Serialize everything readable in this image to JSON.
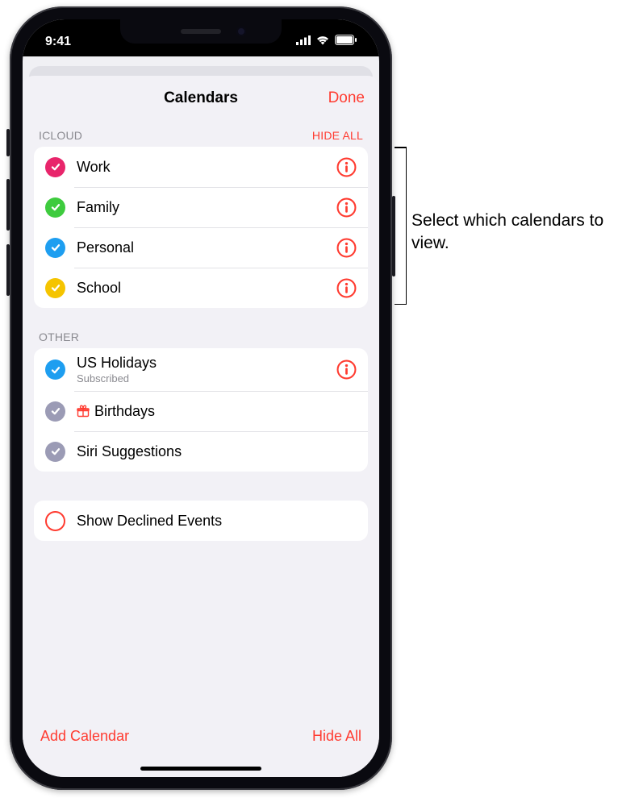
{
  "status": {
    "time": "9:41"
  },
  "header": {
    "title": "Calendars",
    "done": "Done"
  },
  "sections": {
    "icloud": {
      "label": "ICLOUD",
      "hide": "HIDE ALL",
      "items": [
        {
          "name": "Work",
          "color": "#e8256b"
        },
        {
          "name": "Family",
          "color": "#3ecb3e"
        },
        {
          "name": "Personal",
          "color": "#1e9ef0"
        },
        {
          "name": "School",
          "color": "#f5c400"
        }
      ]
    },
    "other": {
      "label": "OTHER",
      "items": [
        {
          "name": "US Holidays",
          "sub": "Subscribed",
          "color": "#1e9ef0",
          "info": true
        },
        {
          "name": "Birthdays",
          "color": "#9b9bb5",
          "gift": true
        },
        {
          "name": "Siri Suggestions",
          "color": "#9b9bb5"
        }
      ]
    },
    "declined": {
      "label": "Show Declined Events"
    }
  },
  "footer": {
    "add": "Add Calendar",
    "hide": "Hide All"
  },
  "callout": "Select which calendars to view."
}
